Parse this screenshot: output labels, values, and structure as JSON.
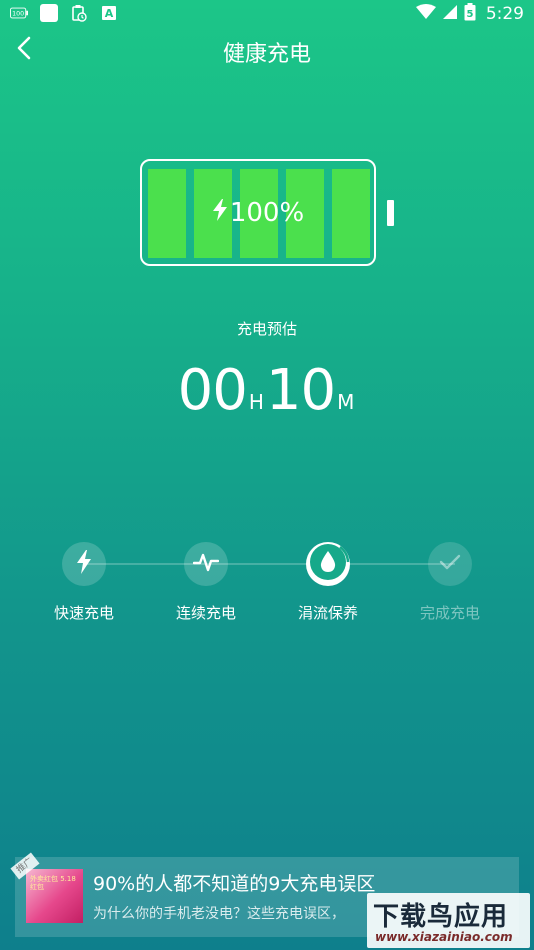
{
  "status_bar": {
    "time": "5:29",
    "battery_level": "5",
    "notification_icons": [
      "battery-100-icon",
      "white-box-icon",
      "clipboard-icon",
      "app-a-icon"
    ],
    "app_badge": "A",
    "signal_icons": [
      "wifi-icon",
      "cellular-icon",
      "battery-icon"
    ]
  },
  "header": {
    "title": "健康充电",
    "back_icon": "chevron-left-icon"
  },
  "battery": {
    "level_label": "100%",
    "level_value": 100,
    "cells": 5,
    "cell_color": "#4be04d"
  },
  "estimate": {
    "label": "充电预估",
    "hours": "00",
    "hour_unit": "H",
    "minutes": "10",
    "minute_unit": "M"
  },
  "steps": [
    {
      "label": "快速充电",
      "icon": "lightning-icon",
      "state": "done"
    },
    {
      "label": "连续充电",
      "icon": "pulse-icon",
      "state": "done"
    },
    {
      "label": "涓流保养",
      "icon": "drop-icon",
      "state": "active"
    },
    {
      "label": "完成充电",
      "icon": "check-icon",
      "state": "pending"
    }
  ],
  "ad": {
    "tag": "推广",
    "thumb_text": "外卖红包 5.18 红包",
    "title": "90%的人都不知道的9大充电误区",
    "subtitle": "为什么你的手机老没电？这些充电误区，"
  },
  "watermark": {
    "text_cn": "下载鸟应用",
    "text_en": "www.xiazainiao.com"
  },
  "colors": {
    "gradient_top": "#1cc688",
    "gradient_bottom": "#0e7f8c",
    "accent_green": "#4be04d"
  }
}
